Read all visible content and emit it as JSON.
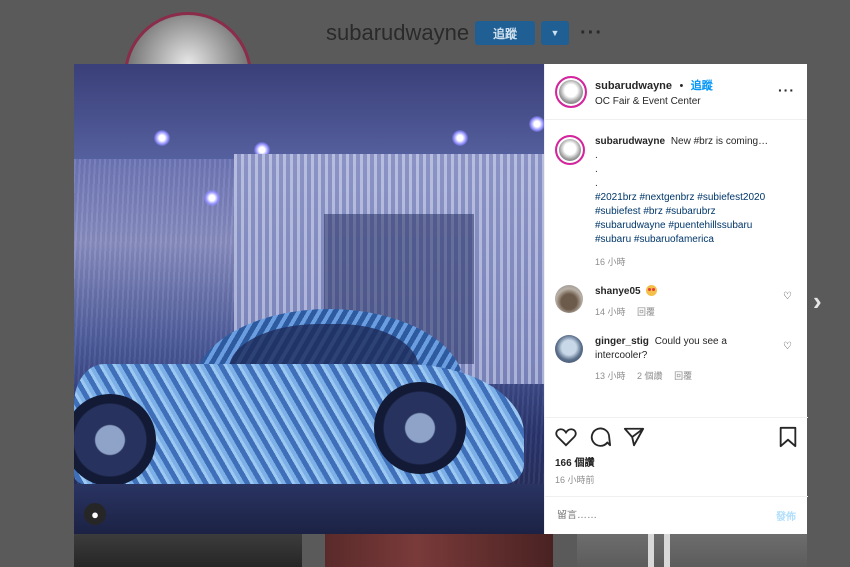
{
  "profile": {
    "username": "subarudwayne",
    "follow_label": "追蹤",
    "dropdown_icon": "caret-down-icon",
    "more_icon": "more-horizontal-icon"
  },
  "navigation": {
    "next_icon": "chevron-right-icon"
  },
  "post": {
    "header": {
      "username": "subarudwayne",
      "separator": "•",
      "follow_label": "追蹤",
      "location": "OC Fair & Event Center"
    },
    "caption": {
      "username": "subarudwayne",
      "text": "New #brz is coming…",
      "dots": [
        ".",
        ".",
        "."
      ],
      "hashtags": [
        "#2021brz #nextgenbrz #subiefest2020",
        "#subiefest #brz #subarubrz",
        "#subarudwayne #puentehillssubaru",
        "#subaru #subaruofamerica"
      ],
      "time": "16 小時"
    },
    "comments": [
      {
        "username": "shanye05",
        "text": "",
        "time": "14 小時",
        "reply_label": "回覆"
      },
      {
        "username": "ginger_stig",
        "text": "Could you see a intercooler?",
        "time": "13 小時",
        "likes_label": "2 個讚",
        "reply_label": "回覆"
      }
    ],
    "likes": "166 個讚",
    "posted_ago": "16 小時前",
    "add_comment_placeholder": "留言……",
    "post_button": "發佈"
  },
  "colors": {
    "accent": "#0095f6",
    "hashtag": "#00376b",
    "muted": "#8e8e8e"
  }
}
